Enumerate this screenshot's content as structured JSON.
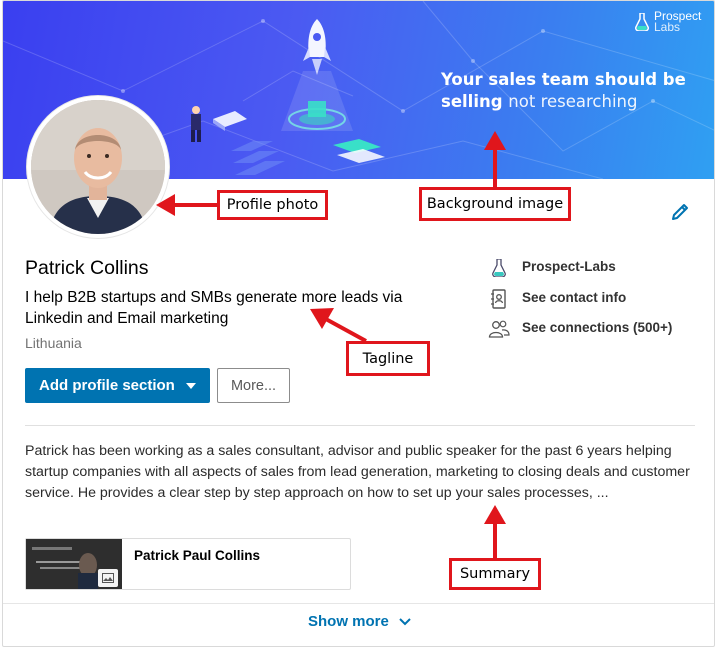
{
  "banner": {
    "headline_bold_1": "Your sales team should be",
    "headline_bold_2": "selling",
    "headline_light": "not researching",
    "brand_line1": "Prospect",
    "brand_line2": "Labs"
  },
  "profile": {
    "name": "Patrick Collins",
    "tagline": "I help B2B startups and SMBs generate more leads via Linkedin and Email marketing",
    "location": "Lithuania"
  },
  "actions": {
    "add_section_label": "Add profile section",
    "more_label": "More..."
  },
  "sidebar": {
    "items": [
      {
        "label": "Prospect-Labs",
        "icon": "prospect-labs-logo-icon"
      },
      {
        "label": "See contact info",
        "icon": "contact-book-icon"
      },
      {
        "label": "See connections (500+)",
        "icon": "people-icon"
      }
    ]
  },
  "summary": {
    "text": "Patrick has been working as a sales consultant, advisor and public speaker for the past 6 years helping startup companies with all aspects of sales from lead generation, marketing to closing deals and customer service. He provides a clear step by step approach on how to set up your sales processes, ...",
    "media_title": "Patrick Paul Collins"
  },
  "footer": {
    "show_more_label": "Show more"
  },
  "annotations": {
    "profile_photo": "Profile photo",
    "background_image": "Background image",
    "tagline": "Tagline",
    "summary": "Summary"
  },
  "colors": {
    "linkedin_blue": "#0073b1",
    "callout_red": "#e0161c",
    "banner_start": "#3a3ff0",
    "banner_end": "#2fa0f2"
  }
}
